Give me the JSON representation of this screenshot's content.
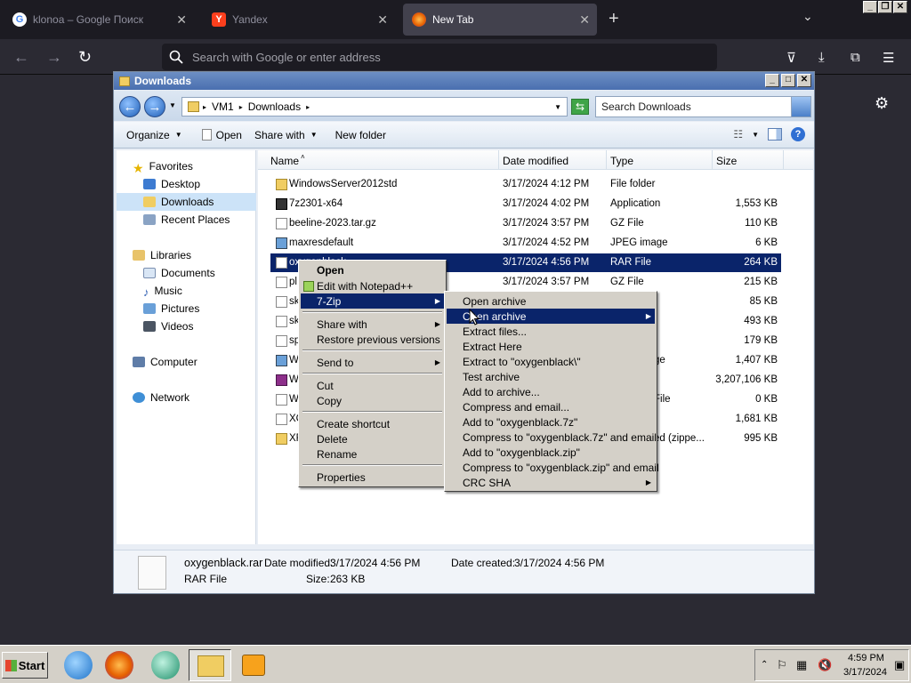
{
  "browser": {
    "tabs": [
      {
        "title": "klonoa – Google Поиск",
        "icon": "google-icon"
      },
      {
        "title": "Yandex",
        "icon": "yandex-icon"
      },
      {
        "title": "New Tab",
        "icon": "firefox-icon"
      }
    ],
    "url_placeholder": "Search with Google or enter address"
  },
  "explorer": {
    "title": "Downloads",
    "breadcrumb": [
      "VM1",
      "Downloads"
    ],
    "search_placeholder": "Search Downloads",
    "toolbar": {
      "organize": "Organize",
      "open": "Open",
      "share_with": "Share with",
      "new_folder": "New folder"
    },
    "nav": {
      "favorites": "Favorites",
      "desktop": "Desktop",
      "downloads": "Downloads",
      "recent": "Recent Places",
      "libraries": "Libraries",
      "documents": "Documents",
      "music": "Music",
      "pictures": "Pictures",
      "videos": "Videos",
      "computer": "Computer",
      "network": "Network"
    },
    "columns": {
      "name": "Name",
      "date": "Date modified",
      "type": "Type",
      "size": "Size"
    },
    "rows": [
      {
        "name": "WindowsServer2012std",
        "date": "3/17/2024 4:12 PM",
        "type": "File folder",
        "size": ""
      },
      {
        "name": "7z2301-x64",
        "date": "3/17/2024 4:02 PM",
        "type": "Application",
        "size": "1,553 KB"
      },
      {
        "name": "beeline-2023.tar.gz",
        "date": "3/17/2024 3:57 PM",
        "type": "GZ File",
        "size": "110 KB"
      },
      {
        "name": "maxresdefault",
        "date": "3/17/2024 4:52 PM",
        "type": "JPEG image",
        "size": "6 KB"
      },
      {
        "name": "oxygenblack",
        "date": "3/17/2024 4:56 PM",
        "type": "RAR File",
        "size": "264 KB"
      },
      {
        "name": "pl",
        "date": "3/17/2024 3:57 PM",
        "type": "GZ File",
        "size": "215 KB"
      },
      {
        "name": "sk",
        "date": "",
        "type": "",
        "size": "85 KB"
      },
      {
        "name": "sk",
        "date": "",
        "type": "",
        "size": "493 KB"
      },
      {
        "name": "sp",
        "date": "",
        "type": "",
        "size": "179 KB"
      },
      {
        "name": "W",
        "date": "",
        "type": "ge",
        "size": "1,407 KB"
      },
      {
        "name": "W",
        "date": "",
        "type": "",
        "size": "3,207,106 KB"
      },
      {
        "name": "W",
        "date": "",
        "type": "File",
        "size": "0 KB"
      },
      {
        "name": "XC",
        "date": "",
        "type": "",
        "size": "1,681 KB"
      },
      {
        "name": "XF",
        "date": "",
        "type": "ed (zippe...",
        "size": "995 KB"
      }
    ],
    "details": {
      "filename": "oxygenblack.rar",
      "filetype": "RAR File",
      "date_modified_label": "Date modified:",
      "date_modified": "3/17/2024 4:56 PM",
      "date_created_label": "Date created:",
      "date_created": "3/17/2024 4:56 PM",
      "size_label": "Size:",
      "size": "263 KB"
    }
  },
  "context_menu": {
    "items": [
      "Open",
      "Edit with Notepad++",
      "7-Zip",
      "Share with",
      "Restore previous versions",
      "Send to",
      "Cut",
      "Copy",
      "Create shortcut",
      "Delete",
      "Rename",
      "Properties"
    ]
  },
  "submenu_7zip": {
    "items": [
      "Open archive",
      "Open archive",
      "Extract files...",
      "Extract Here",
      "Extract to \"oxygenblack\\\"",
      "Test archive",
      "Add to archive...",
      "Compress and email...",
      "Add to \"oxygenblack.7z\"",
      "Compress to \"oxygenblack.7z\" and email",
      "Add to \"oxygenblack.zip\"",
      "Compress to \"oxygenblack.zip\" and email",
      "CRC SHA"
    ]
  },
  "taskbar": {
    "start": "Start",
    "time": "4:59 PM",
    "date": "3/17/2024"
  }
}
